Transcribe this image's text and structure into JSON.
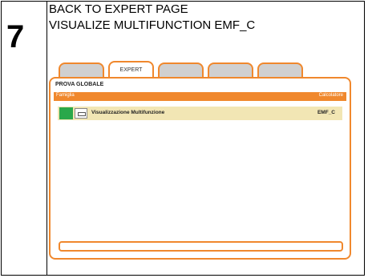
{
  "step": {
    "number": "7"
  },
  "title": {
    "line1": "BACK TO EXPERT PAGE",
    "line2": "VISUALIZE MULTIFUNCTION  EMF_C"
  },
  "tabs": [
    {
      "label": "",
      "active": false
    },
    {
      "label": "EXPERT",
      "active": true
    },
    {
      "label": "",
      "active": false
    },
    {
      "label": "",
      "active": false
    },
    {
      "label": "",
      "active": false
    }
  ],
  "panel": {
    "title": "PROVA GLOBALE",
    "header": {
      "left": "Famiglia",
      "right": "Calcolatore"
    },
    "rows": [
      {
        "label": "Visualizzazione Multifunzione",
        "code": "EMF_C"
      }
    ]
  },
  "colors": {
    "accent": "#f0882d",
    "row_bg": "#f2e6b4",
    "status_green": "#2aa84a"
  }
}
